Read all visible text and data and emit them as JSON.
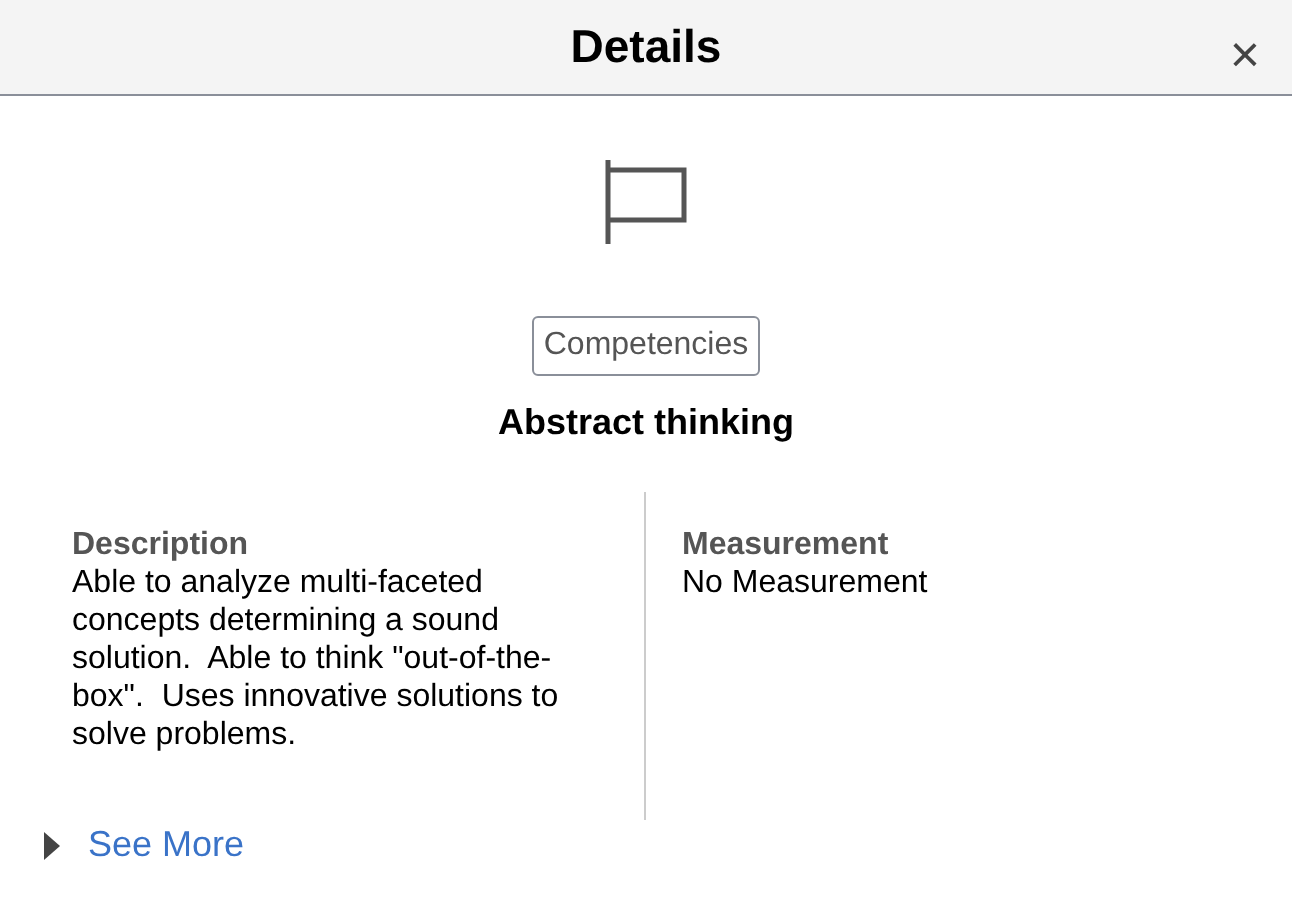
{
  "header": {
    "title": "Details",
    "close": "×"
  },
  "category_button": {
    "label": "Competencies"
  },
  "item_title": "Abstract thinking",
  "sections": [
    {
      "heading": "Description",
      "text": "Able to analyze multi-faceted concepts determining a sound solution.  Able to think \"out-of-the-box\".  Uses innovative solutions to solve problems."
    },
    {
      "heading": "Measurement",
      "text": "No Measurement"
    }
  ],
  "see_more": {
    "label": "See More",
    "expanded": false
  }
}
